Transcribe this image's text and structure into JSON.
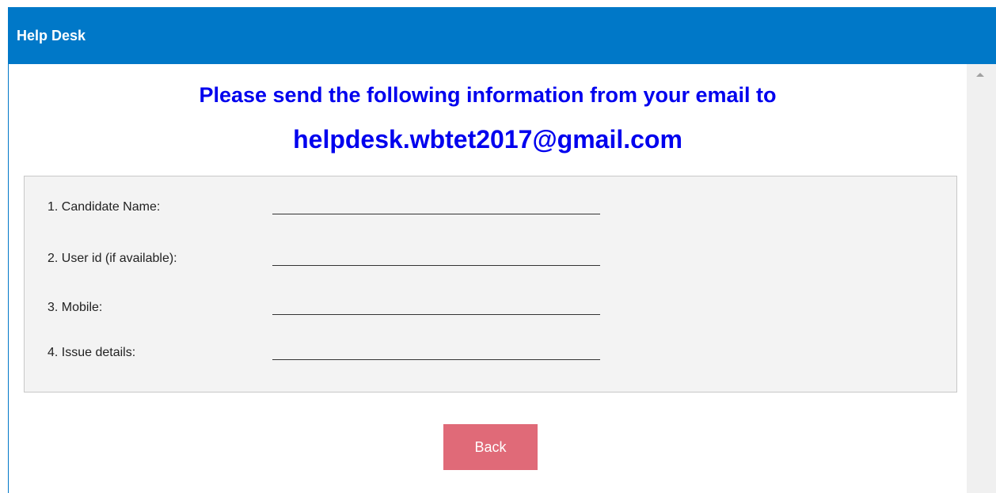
{
  "window": {
    "title": "Help Desk"
  },
  "heading": {
    "line1": "Please send the following information from your email to",
    "email": "helpdesk.wbtet2017@gmail.com"
  },
  "form": {
    "fields": [
      {
        "label": "1. Candidate Name:"
      },
      {
        "label": "2. User id (if available):"
      },
      {
        "label": "3. Mobile:"
      },
      {
        "label": "4. Issue details:"
      }
    ]
  },
  "actions": {
    "back_label": "Back"
  },
  "colors": {
    "title_bar": "#0078c8",
    "heading_text": "#0000ee",
    "box_background": "#f3f3f3",
    "back_button": "#e06a78"
  },
  "icons": {
    "scroll_up": "scroll-up-arrow-icon"
  }
}
